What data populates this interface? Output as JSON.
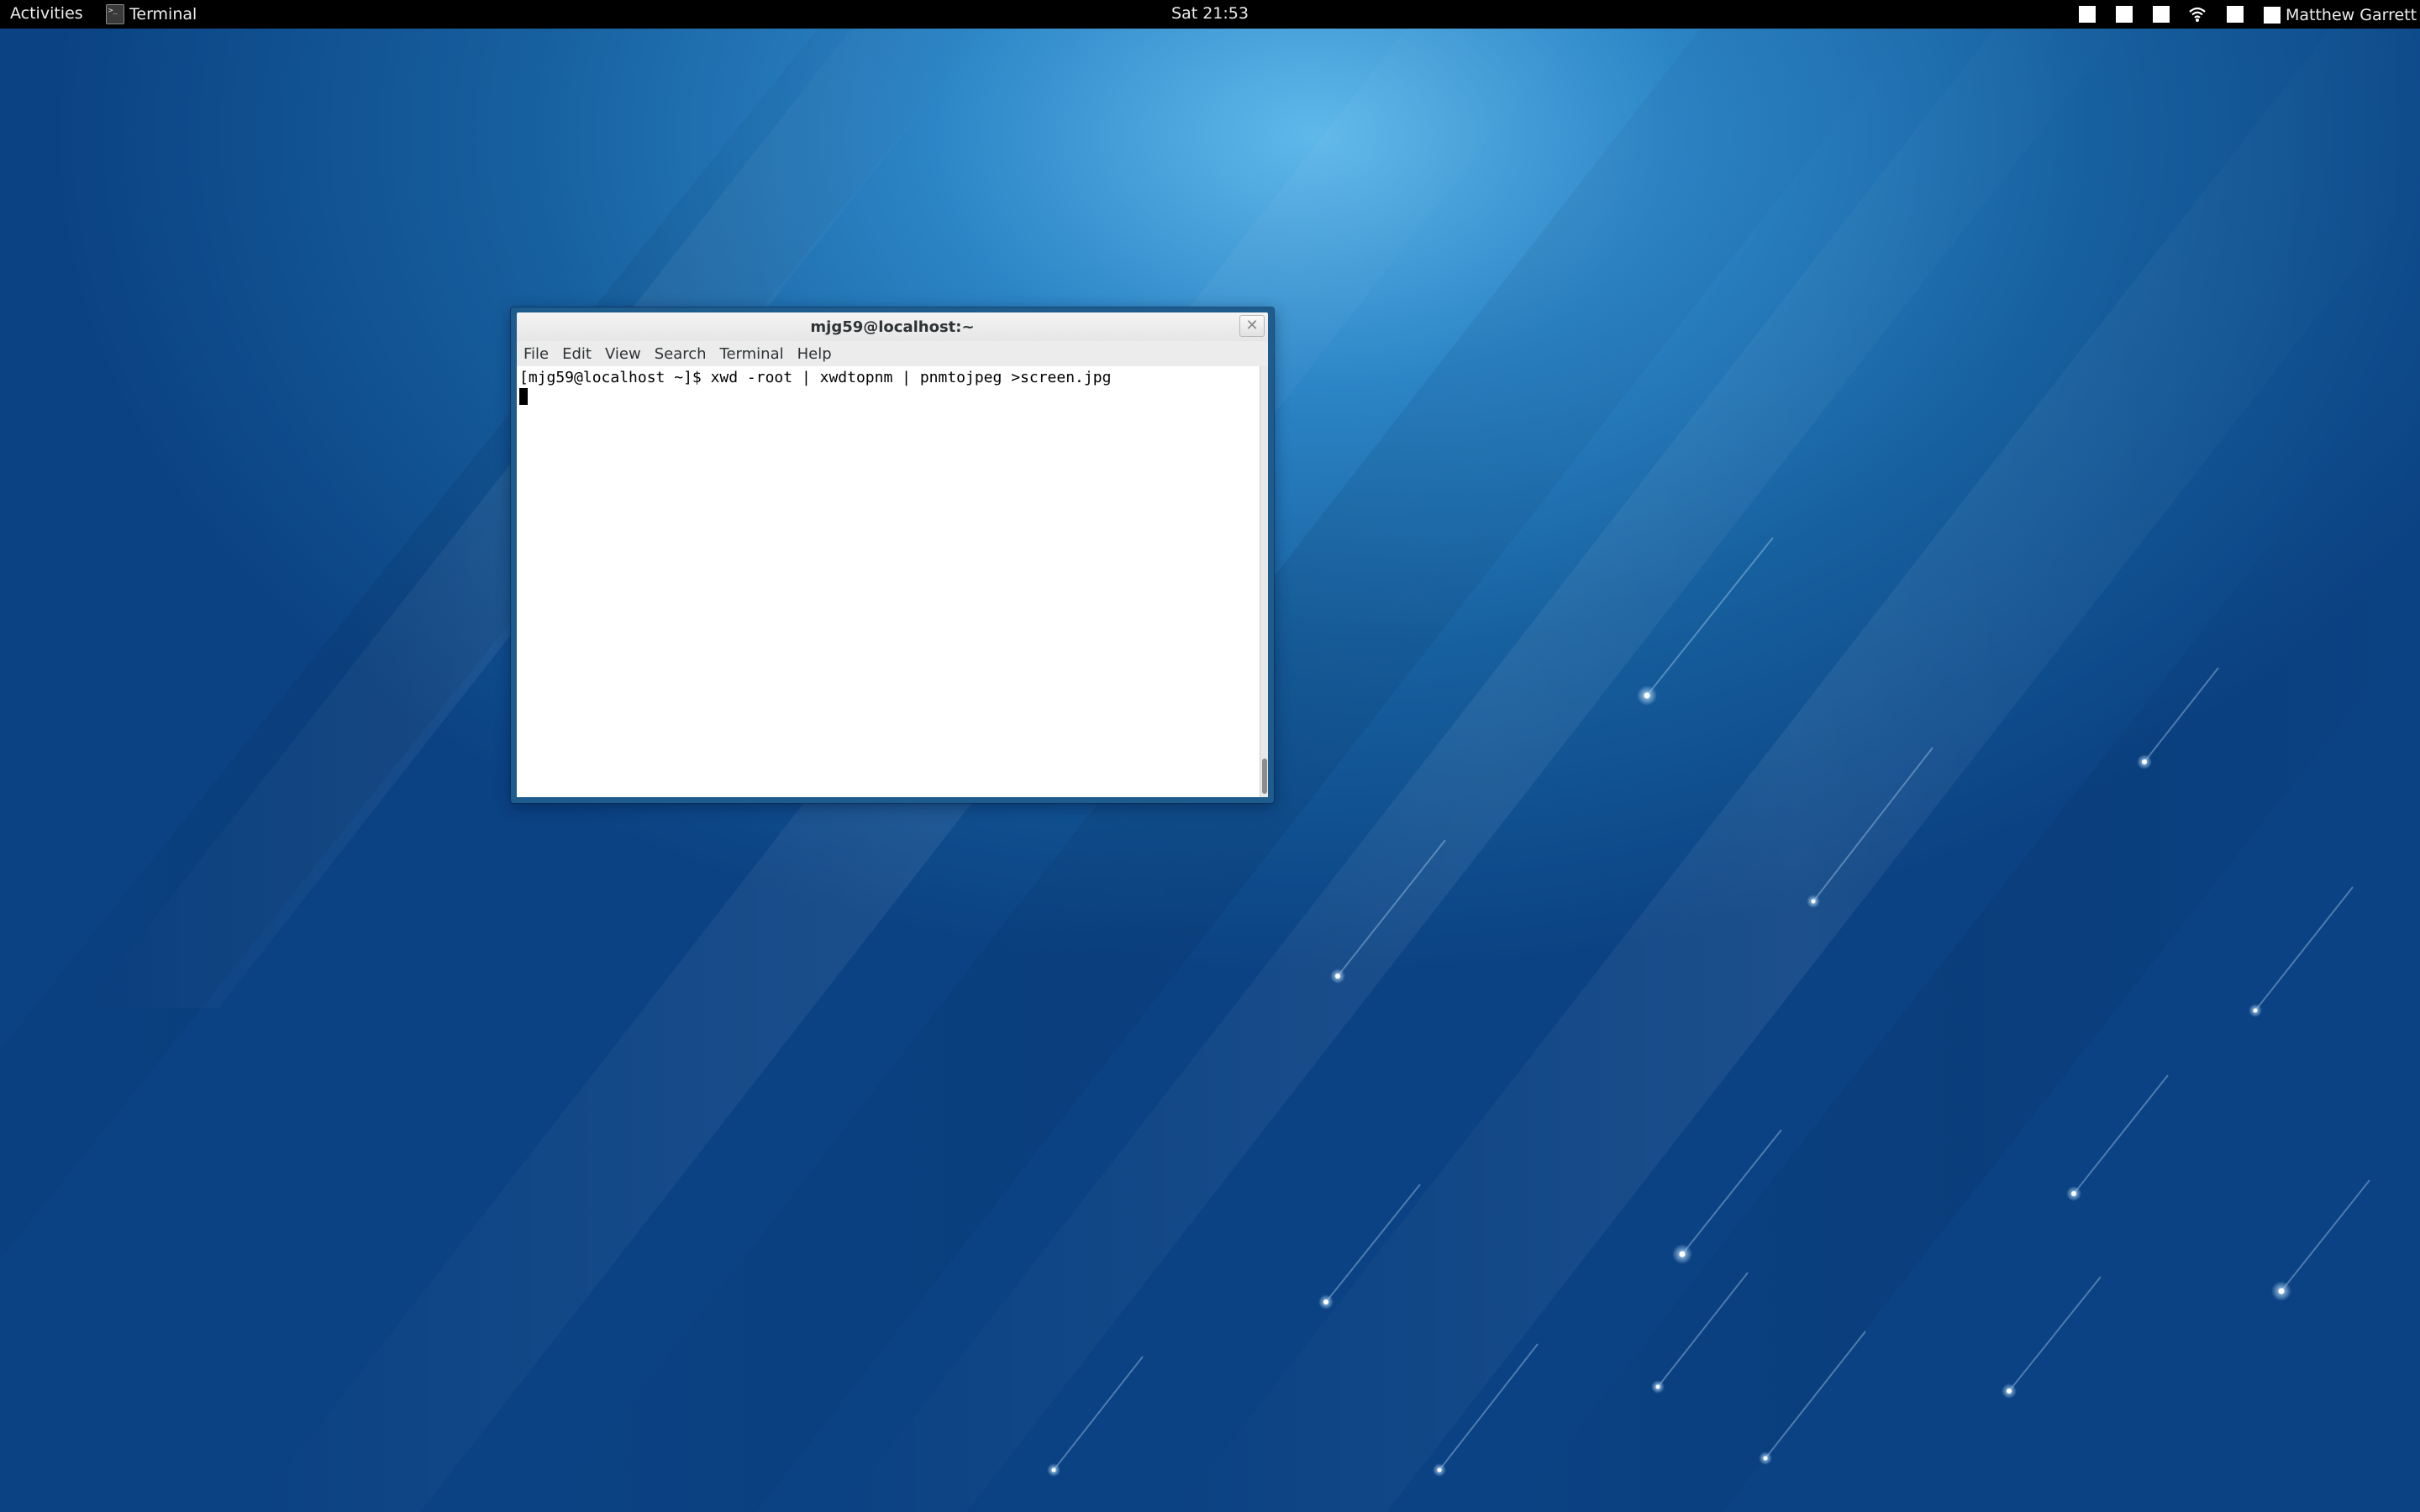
{
  "topbar": {
    "activities_label": "Activities",
    "app_name": "Terminal",
    "clock": "Sat 21:53",
    "user_name": "Matthew Garrett"
  },
  "terminal": {
    "title": "mjg59@localhost:~",
    "close_glyph": "✕",
    "menu": [
      "File",
      "Edit",
      "View",
      "Search",
      "Terminal",
      "Help"
    ],
    "lines": [
      "[mjg59@localhost ~]$ xwd -root | xwdtopnm | pnmtojpeg >screen.jpg"
    ]
  },
  "colors": {
    "topbar": "#000000",
    "wallpaper_dark": "#0b4283",
    "wallpaper_light": "#5fb8ea",
    "window_frame": "#1f5c8e"
  },
  "icons": {
    "app_icon": "terminal-icon",
    "wifi": "wifi-icon",
    "close": "close-icon"
  }
}
